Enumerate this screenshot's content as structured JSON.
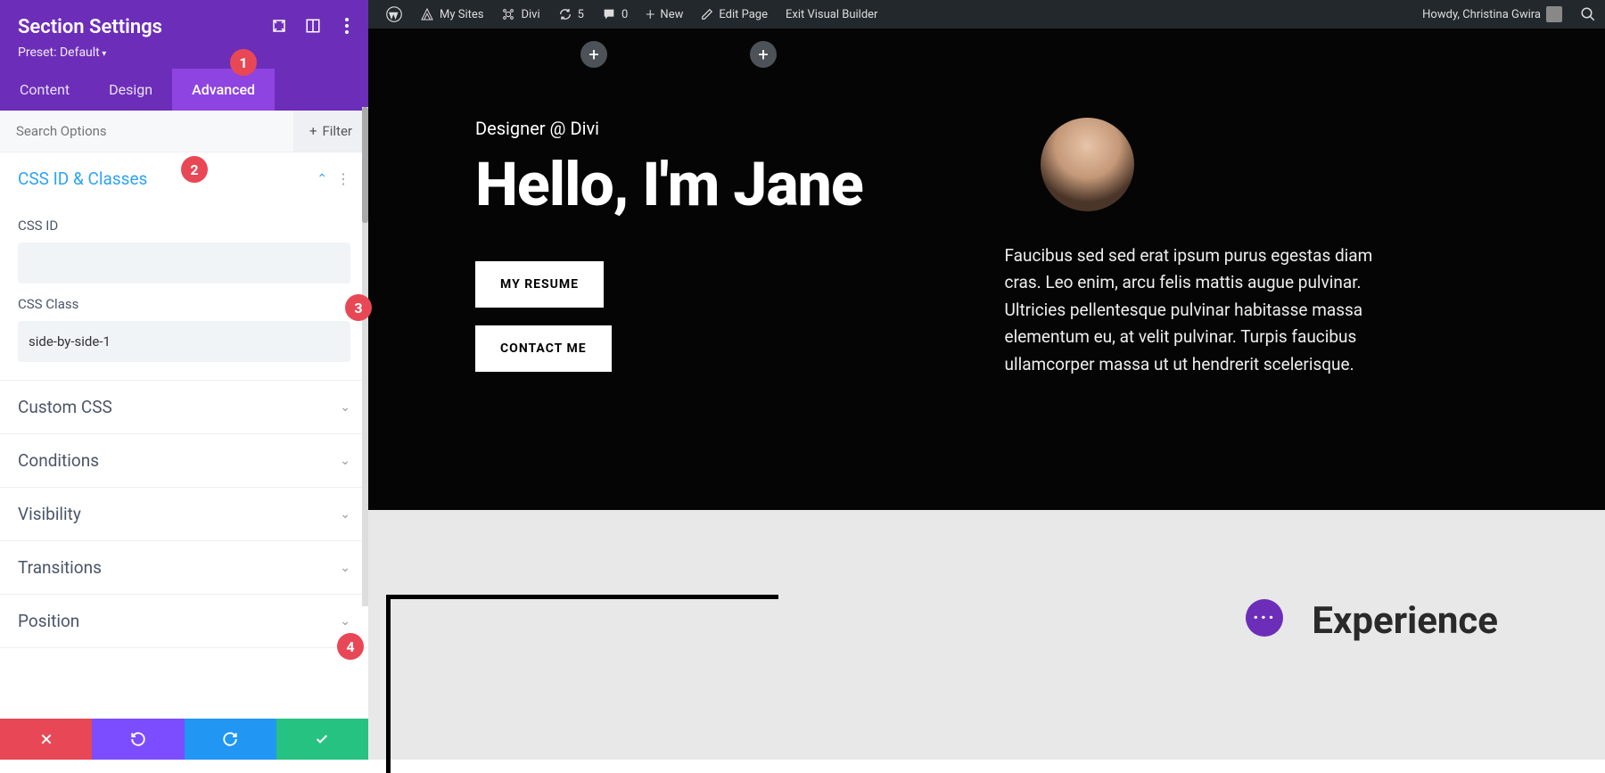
{
  "panel": {
    "title": "Section Settings",
    "preset": "Preset: Default",
    "tabs": {
      "content": "Content",
      "design": "Design",
      "advanced": "Advanced"
    },
    "search_placeholder": "Search Options",
    "filter_label": "Filter",
    "groups": {
      "css_id_classes": "CSS ID & Classes",
      "custom_css": "Custom CSS",
      "conditions": "Conditions",
      "visibility": "Visibility",
      "transitions": "Transitions",
      "position": "Position"
    },
    "fields": {
      "css_id_label": "CSS ID",
      "css_id_value": "",
      "css_class_label": "CSS Class",
      "css_class_value": "side-by-side-1"
    }
  },
  "adminbar": {
    "my_sites": "My Sites",
    "site_name": "Divi",
    "updates": "5",
    "comments": "0",
    "new": "New",
    "edit_page": "Edit Page",
    "exit_vb": "Exit Visual Builder",
    "howdy": "Howdy, Christina Gwira"
  },
  "hero": {
    "subtitle": "Designer @ Divi",
    "headline": "Hello, I'm Jane",
    "resume_btn": "MY RESUME",
    "contact_btn": "CONTACT ME",
    "bio": "Faucibus sed sed erat ipsum purus egestas diam cras. Leo enim, arcu felis mattis augue pulvinar. Ultricies pellentesque pulvinar habitasse massa elementum eu, at velit pulvinar. Turpis faucibus ullamcorper massa ut ut hendrerit scelerisque."
  },
  "experience_title": "Experience",
  "annotations": {
    "a1": "1",
    "a2": "2",
    "a3": "3",
    "a4": "4"
  }
}
